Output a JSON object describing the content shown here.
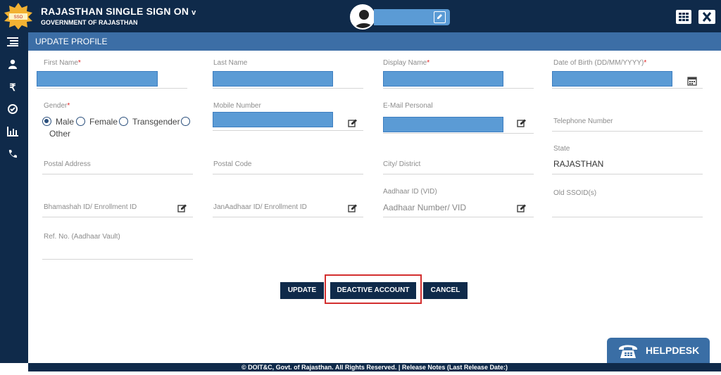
{
  "header": {
    "title": "RAJASTHAN SINGLE SIGN ON",
    "title_arrow": "v",
    "subtitle": "GOVERNMENT OF RAJASTHAN"
  },
  "section": {
    "title": "UPDATE PROFILE"
  },
  "fields": {
    "first_name": "First Name",
    "last_name": "Last Name",
    "display_name": "Display Name",
    "dob": "Date of Birth (DD/MM/YYYY)",
    "gender": "Gender",
    "mobile": "Mobile Number",
    "email": "E-Mail Personal",
    "telephone": "Telephone Number",
    "state": "State",
    "state_value": "RAJASTHAN",
    "postal_address": "Postal Address",
    "postal_code": "Postal Code",
    "city": "City/ District",
    "aadhaar_label": "Aadhaar ID (VID)",
    "aadhaar_placeholder": "Aadhaar Number/ VID",
    "old_ssoid": "Old SSOID(s)",
    "bhamashah": "Bhamashah ID/ Enrollment ID",
    "janaadhaar": "JanAadhaar ID/ Enrollment ID",
    "ref_no": "Ref. No. (Aadhaar Vault)",
    "required_mark": "*"
  },
  "gender_options": [
    "Male",
    "Female",
    "Transgender",
    "Other"
  ],
  "buttons": {
    "update": "UPDATE",
    "deactivate": "DEACTIVE ACCOUNT",
    "cancel": "CANCEL"
  },
  "footer": "© DOIT&C, Govt. of Rajasthan. All Rights Reserved.  |  Release Notes (Last Release Date:)",
  "helpdesk": "HELPDESK",
  "colors": {
    "navy": "#0f2a4a",
    "section": "#3c6ea6",
    "field_fill": "#5b9bd5",
    "highlight": "#d32f2f"
  }
}
